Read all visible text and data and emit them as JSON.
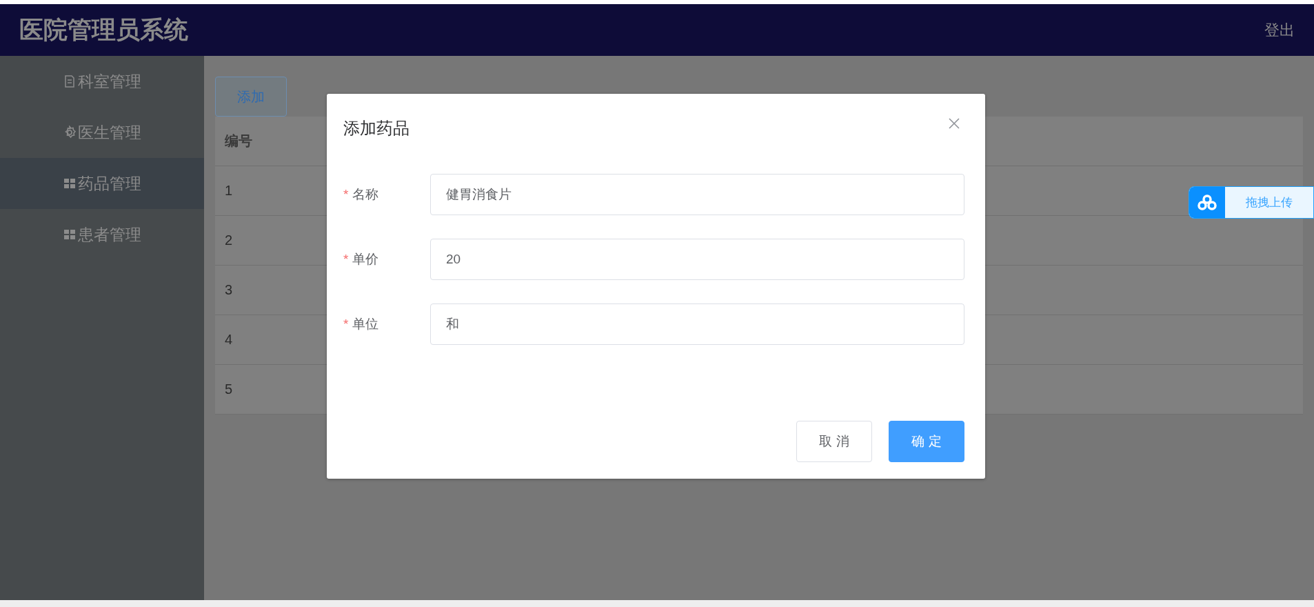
{
  "header": {
    "title": "医院管理员系统",
    "logout": "登出"
  },
  "sidebar": {
    "items": [
      {
        "label": "科室管理",
        "kind": "document",
        "selected": false
      },
      {
        "label": "医生管理",
        "kind": "gear",
        "selected": false
      },
      {
        "label": "药品管理",
        "kind": "grid",
        "selected": true
      },
      {
        "label": "患者管理",
        "kind": "grid",
        "selected": false
      }
    ]
  },
  "toolbar": {
    "add_button": "添加"
  },
  "table": {
    "columns": [
      "编号"
    ],
    "rows": [
      [
        "1"
      ],
      [
        "2"
      ],
      [
        "3"
      ],
      [
        "4"
      ],
      [
        "5"
      ]
    ]
  },
  "dialog": {
    "title": "添加药品",
    "fields": [
      {
        "label": "名称",
        "required_mark": "*",
        "value": "健胃消食片"
      },
      {
        "label": "单价",
        "required_mark": "*",
        "value": "20"
      },
      {
        "label": "单位",
        "required_mark": "*",
        "value": "和"
      }
    ],
    "buttons": [
      {
        "label": "取 消",
        "kind": "default"
      },
      {
        "label": "确 定",
        "kind": "primary"
      }
    ]
  },
  "upload_widget": {
    "label": "拖拽上传"
  }
}
